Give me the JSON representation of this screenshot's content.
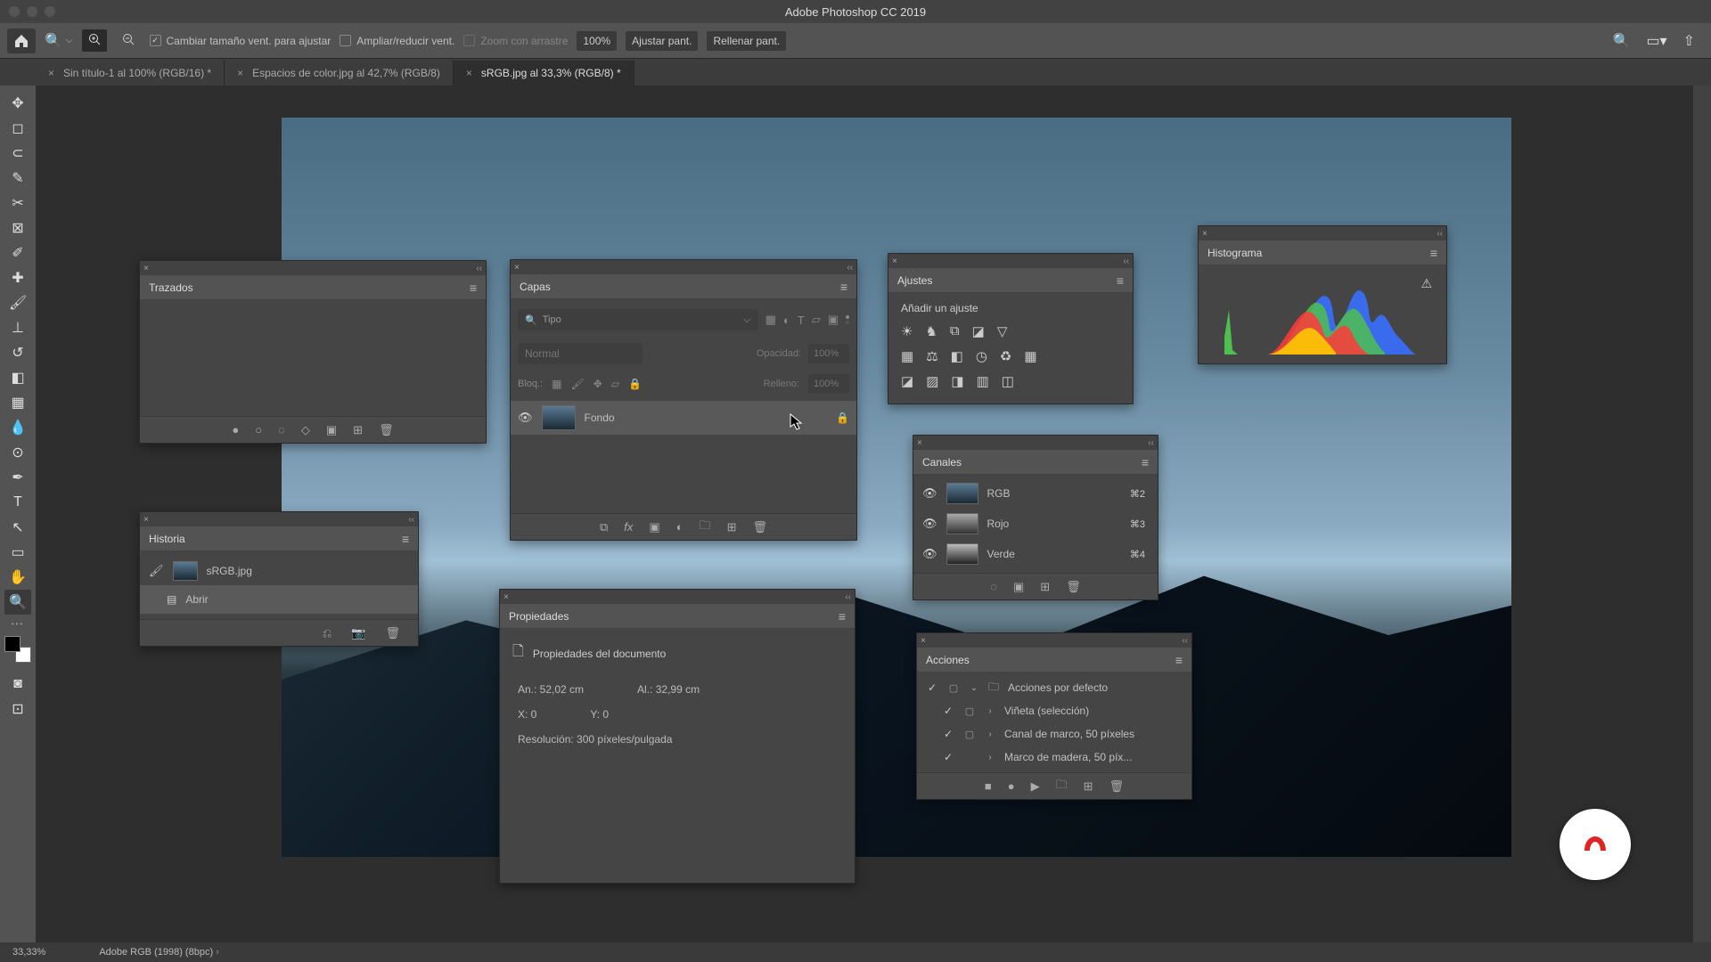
{
  "app_title": "Adobe Photoshop CC 2019",
  "options_bar": {
    "resize_windows": "Cambiar tamaño vent. para ajustar",
    "zoom_all": "Ampliar/reducir vent.",
    "scrubby": "Zoom con arrastre",
    "zoom_pct": "100%",
    "fit_screen": "Ajustar pant.",
    "fill_screen": "Rellenar pant."
  },
  "tabs": [
    {
      "label": "Sin título-1 al 100% (RGB/16) *",
      "active": false
    },
    {
      "label": "Espacios de color.jpg al 42,7% (RGB/8)",
      "active": false
    },
    {
      "label": "sRGB.jpg al 33,3% (RGB/8) *",
      "active": true
    }
  ],
  "panels": {
    "trazados": {
      "title": "Trazados"
    },
    "historia": {
      "title": "Historia",
      "source": "sRGB.jpg",
      "items": [
        "Abrir"
      ]
    },
    "capas": {
      "title": "Capas",
      "filter_label": "Tipo",
      "blend_mode": "Normal",
      "opacity_label": "Opacidad:",
      "opacity_val": "100%",
      "lock_label": "Bloq.:",
      "fill_label": "Relleno:",
      "fill_val": "100%",
      "layer_name": "Fondo"
    },
    "propiedades": {
      "title": "Propiedades",
      "heading": "Propiedades del documento",
      "width": "An.: 52,02 cm",
      "height": "Al.: 32,99 cm",
      "x": "X: 0",
      "y": "Y: 0",
      "resolution": "Resolución: 300 píxeles/pulgada"
    },
    "ajustes": {
      "title": "Ajustes",
      "add_label": "Añadir un ajuste"
    },
    "canales": {
      "title": "Canales",
      "rows": [
        {
          "name": "RGB",
          "sc": "⌘2"
        },
        {
          "name": "Rojo",
          "sc": "⌘3"
        },
        {
          "name": "Verde",
          "sc": "⌘4"
        }
      ]
    },
    "acciones": {
      "title": "Acciones",
      "items": [
        {
          "exp": "⌄",
          "icon": "▿",
          "label": "Acciones por defecto",
          "folder": true
        },
        {
          "exp": "›",
          "icon": "",
          "label": "Viñeta (selección)"
        },
        {
          "exp": "›",
          "icon": "",
          "label": "Canal de marco, 50 píxeles"
        },
        {
          "exp": "›",
          "icon": "",
          "label": "Marco de madera, 50 píx..."
        }
      ]
    },
    "histograma": {
      "title": "Histograma"
    }
  },
  "status": {
    "zoom": "33,33%",
    "profile": "Adobe RGB (1998) (8bpc)"
  }
}
